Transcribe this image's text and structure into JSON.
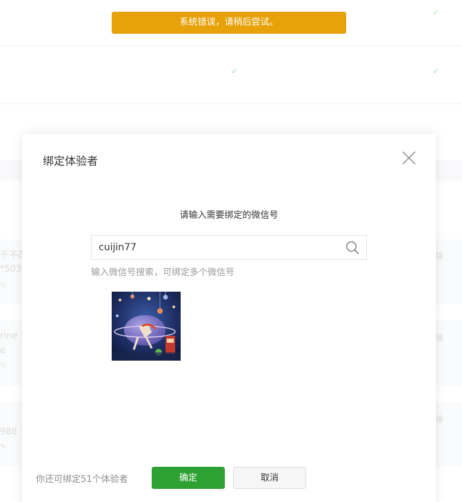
{
  "toast": {
    "message": "系统错误，请稍后尝试。"
  },
  "background": {
    "rows": [
      {
        "left_text": "",
        "right_text": ""
      },
      {
        "left_text": "",
        "right_text": ""
      },
      {
        "left_text": "",
        "right_text": ""
      }
    ],
    "members": [
      {
        "line1": "千不改",
        "line2": "*503",
        "action": "除"
      },
      {
        "line1": "rine",
        "line2": "e",
        "action": "除"
      },
      {
        "line1": "988",
        "line2": "",
        "action": "除"
      }
    ]
  },
  "dialog": {
    "title": "绑定体验者",
    "prompt": "请输入需要绑定的微信号",
    "search": {
      "value": "cuijin77",
      "hint": "输入微信号搜索，可绑定多个微信号"
    },
    "footer_note": "你还可绑定51个体验者",
    "confirm_label": "确定",
    "cancel_label": "取消"
  },
  "colors": {
    "toast_bg": "#e7a109",
    "primary": "#2ea133",
    "check": "#5cbc6a"
  },
  "icons": [
    "check-icon",
    "close-icon",
    "search-icon",
    "pencil-icon",
    "avatar-image"
  ]
}
